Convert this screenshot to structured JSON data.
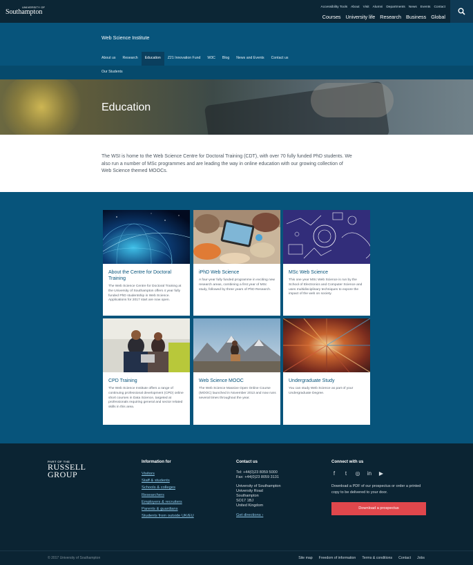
{
  "header": {
    "logo_small": "UNIVERSITY OF",
    "logo_big": "Southampton",
    "utility_links": [
      "Accessibility Tools",
      "About",
      "Visit",
      "Alumni",
      "Departments",
      "News",
      "Events",
      "Contact"
    ],
    "main_nav": [
      "Courses",
      "University life",
      "Research",
      "Business",
      "Global"
    ],
    "search_icon": "search-icon"
  },
  "institute": {
    "title": "Web Science Institute",
    "nav": [
      "About us",
      "Research",
      "Education",
      "Z21 Innovation Fund",
      "W3C",
      "Blog",
      "News and Events",
      "Contact us"
    ],
    "active_index": 2,
    "sub_nav": "Our Students"
  },
  "hero": {
    "title": "Education"
  },
  "intro": {
    "text": "The WSI is home to the Web Science Centre for Doctoral Training (CDT), with over 70 fully funded PhD students. We also run a number of MSc programmes and are leading the way in online education with our growing collection of Web Science themed MOOCs."
  },
  "cards": [
    {
      "title": "About the Centre for Doctoral Training",
      "desc": "The Web Science Centre for Doctoral Training at the University of Southampton offers 4 year fully funded PhD studentship in Web Science. Applications for 2017 start are now open."
    },
    {
      "title": "iPhD Web Science",
      "desc": "A four-year fully funded programme in exciting new research areas, combining a first year of MSc study, followed by three years of PhD Research."
    },
    {
      "title": "MSc Web Science",
      "desc": "This one year MSc Web Science is run by the School of Electronics and Computer Science and uses multidisciplinary techniques to expore the impact of the web on society."
    },
    {
      "title": "CPD Training",
      "desc": "The Web Science Institute offers a range of continuing professional development (CPD) online short courses in Data Science, targeted at professionals requiring general and sector related skills in this area."
    },
    {
      "title": "Web Science MOOC",
      "desc": "The Web Science Massive Open Online Course (MOOC) launched in November 2013 and now runs several times throughout the year."
    },
    {
      "title": "Undergraduate Study",
      "desc": "You can study Web Science as part of your Undergraduate Degree."
    }
  ],
  "footer": {
    "russell_part_of": "PART OF THE",
    "russell_1": "RUSSELL",
    "russell_2": "GROUP",
    "info_heading": "Information for",
    "info_links": [
      "Visitors",
      "Staff & students",
      "Schools & colleges",
      "Researchers",
      "Employers & recruiters",
      "Parents & guardians",
      "Students from outside UK/EU"
    ],
    "contact_heading": "Contact us",
    "tel": "Tel: +44(0)23 8059 5000",
    "fax": "Fax: +44(0)23 8059 3131",
    "address": [
      "University of Southampton",
      "University Road",
      "Southampton",
      "SO17 1BJ",
      "United Kingdom"
    ],
    "directions": "Get directions ›",
    "connect_heading": "Connect with us",
    "social": [
      "facebook-icon",
      "twitter-icon",
      "instagram-icon",
      "linkedin-icon",
      "youtube-icon"
    ],
    "social_glyphs": [
      "f",
      "t",
      "◎",
      "in",
      "▶"
    ],
    "prospectus_text": "Download a PDF of our prospectus or order a printed copy to be delivered to your door.",
    "prospectus_button": "Download a prospectus",
    "copyright": "© 2017 University of Southampton",
    "bottom_links": [
      "Site map",
      "Freedom of information",
      "Terms & conditions",
      "Contact",
      "Jobs"
    ]
  },
  "colors": {
    "brand_blue": "#07547b",
    "dark": "#0b2433",
    "cta_red": "#e0474c",
    "link_blue": "#8cc6e6"
  }
}
